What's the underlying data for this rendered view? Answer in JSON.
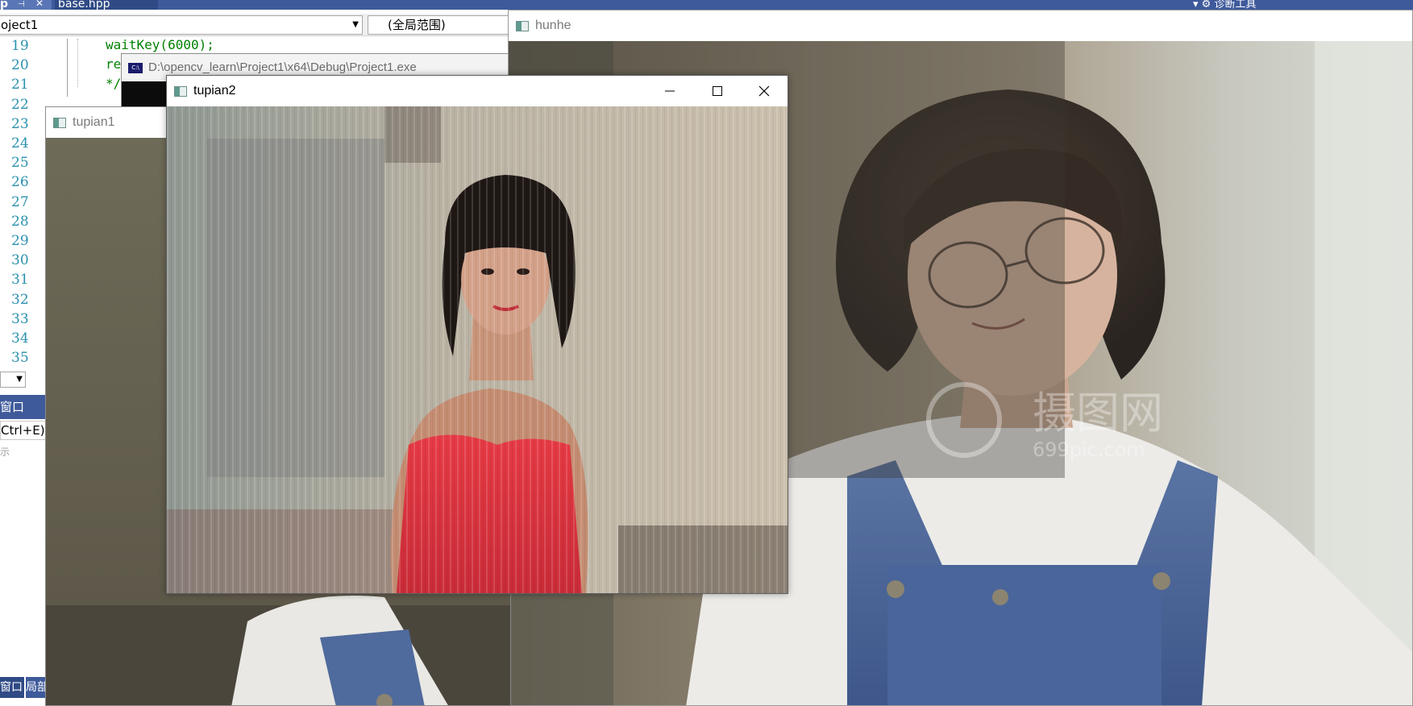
{
  "vs": {
    "tabs": [
      {
        "label": "p"
      },
      {
        "label": "base.hpp"
      }
    ],
    "tab_pin_glyph": "⊣",
    "tab_close_glyph": "✕",
    "right_toolbar_text": "▾  ⚙  诊断工具",
    "project_combo_value": "oject1",
    "scope_combo_value": "(全局范围)",
    "line_numbers": [
      "19",
      "20",
      "21",
      "22",
      "23",
      "24",
      "25",
      "26",
      "27",
      "28",
      "29",
      "30",
      "31",
      "32",
      "33",
      "34",
      "35"
    ],
    "code_lines": [
      "waitKey(6000);",
      "re",
      "*/"
    ],
    "panel_header": "窗口",
    "panel_search": "Ctrl+E)",
    "panel_hint": "示",
    "bottom_tabs": [
      "窗口",
      "局部"
    ]
  },
  "windows": {
    "console": {
      "title": "D:\\opencv_learn\\Project1\\x64\\Debug\\Project1.exe",
      "icon_text": "C:\\"
    },
    "hunhe": {
      "title": "hunhe",
      "image_alt": "blended image of a girl with glasses in denim overalls"
    },
    "tupian1": {
      "title": "tupian1",
      "image_alt": "girl with glasses in denim overalls"
    },
    "tupian2": {
      "title": "tupian2",
      "image_alt": "woman in red strapless dress in front of a curtain",
      "minimize_icon": "minimize-icon",
      "maximize_icon": "maximize-icon",
      "close_icon": "close-icon"
    }
  },
  "watermark": {
    "main": "摄图网",
    "sub": "699pic.com"
  }
}
